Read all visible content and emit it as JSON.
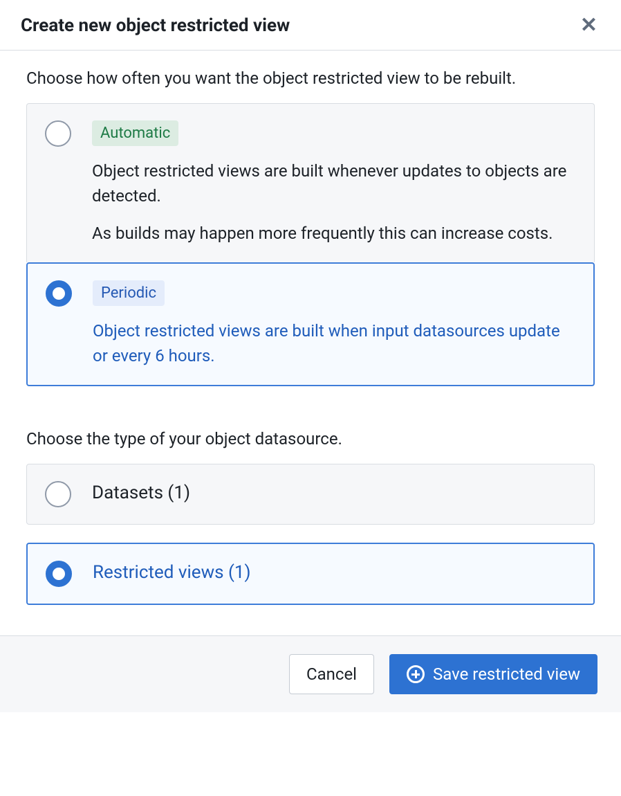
{
  "dialog": {
    "title": "Create new object restricted view"
  },
  "rebuild": {
    "prompt": "Choose how often you want the object restricted view to be rebuilt.",
    "options": [
      {
        "tag": "Automatic",
        "desc1": "Object restricted views are built whenever updates to objects are detected.",
        "desc2": "As builds may happen more frequently this can increase costs.",
        "selected": false
      },
      {
        "tag": "Periodic",
        "desc1": "Object restricted views are built when input datasources update or every 6 hours.",
        "selected": true
      }
    ]
  },
  "datasource": {
    "prompt": "Choose the type of your object datasource.",
    "options": [
      {
        "label": "Datasets (1)",
        "selected": false
      },
      {
        "label": "Restricted views (1)",
        "selected": true
      }
    ]
  },
  "footer": {
    "cancel": "Cancel",
    "save": "Save restricted view"
  }
}
